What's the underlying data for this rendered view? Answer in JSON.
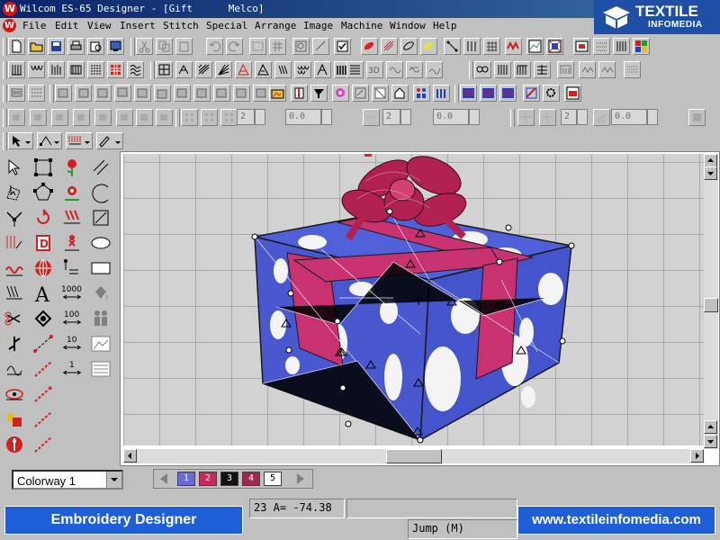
{
  "window": {
    "title": "Wilcom ES-65 Designer - [Gift      Melco]",
    "logo_letter": "W"
  },
  "brand": {
    "line1": "TEXTILE",
    "line2": "INFOMEDIA",
    "color": "#1e4fa5"
  },
  "menu": {
    "items": [
      "File",
      "Edit",
      "View",
      "Insert",
      "Stitch",
      "Special",
      "Arrange",
      "Image",
      "Machine",
      "Window",
      "Help"
    ]
  },
  "toolbar": {
    "spin_values": [
      "2",
      "0.0",
      "2",
      "0.0",
      "2",
      "0.0"
    ]
  },
  "colorway": {
    "label": "Colorway 1"
  },
  "palette": {
    "swatches": [
      {
        "label": "1",
        "color": "#6a6ad8"
      },
      {
        "label": "2",
        "color": "#c8285a"
      },
      {
        "label": "3",
        "color": "#111111"
      },
      {
        "label": "4",
        "color": "#a02850"
      },
      {
        "label": "5",
        "color": "#ffffff"
      }
    ]
  },
  "status": {
    "coords": "23 A= -74.38",
    "mode": "Jump (M)",
    "footer_left": "Embroidery Designer",
    "footer_right": "www.textileinfomedia.com",
    "footer_color": "#1e5fd8"
  },
  "design": {
    "box_color": "#5060d8",
    "ribbon_color": "#c83270",
    "bow_color": "#b02050"
  }
}
